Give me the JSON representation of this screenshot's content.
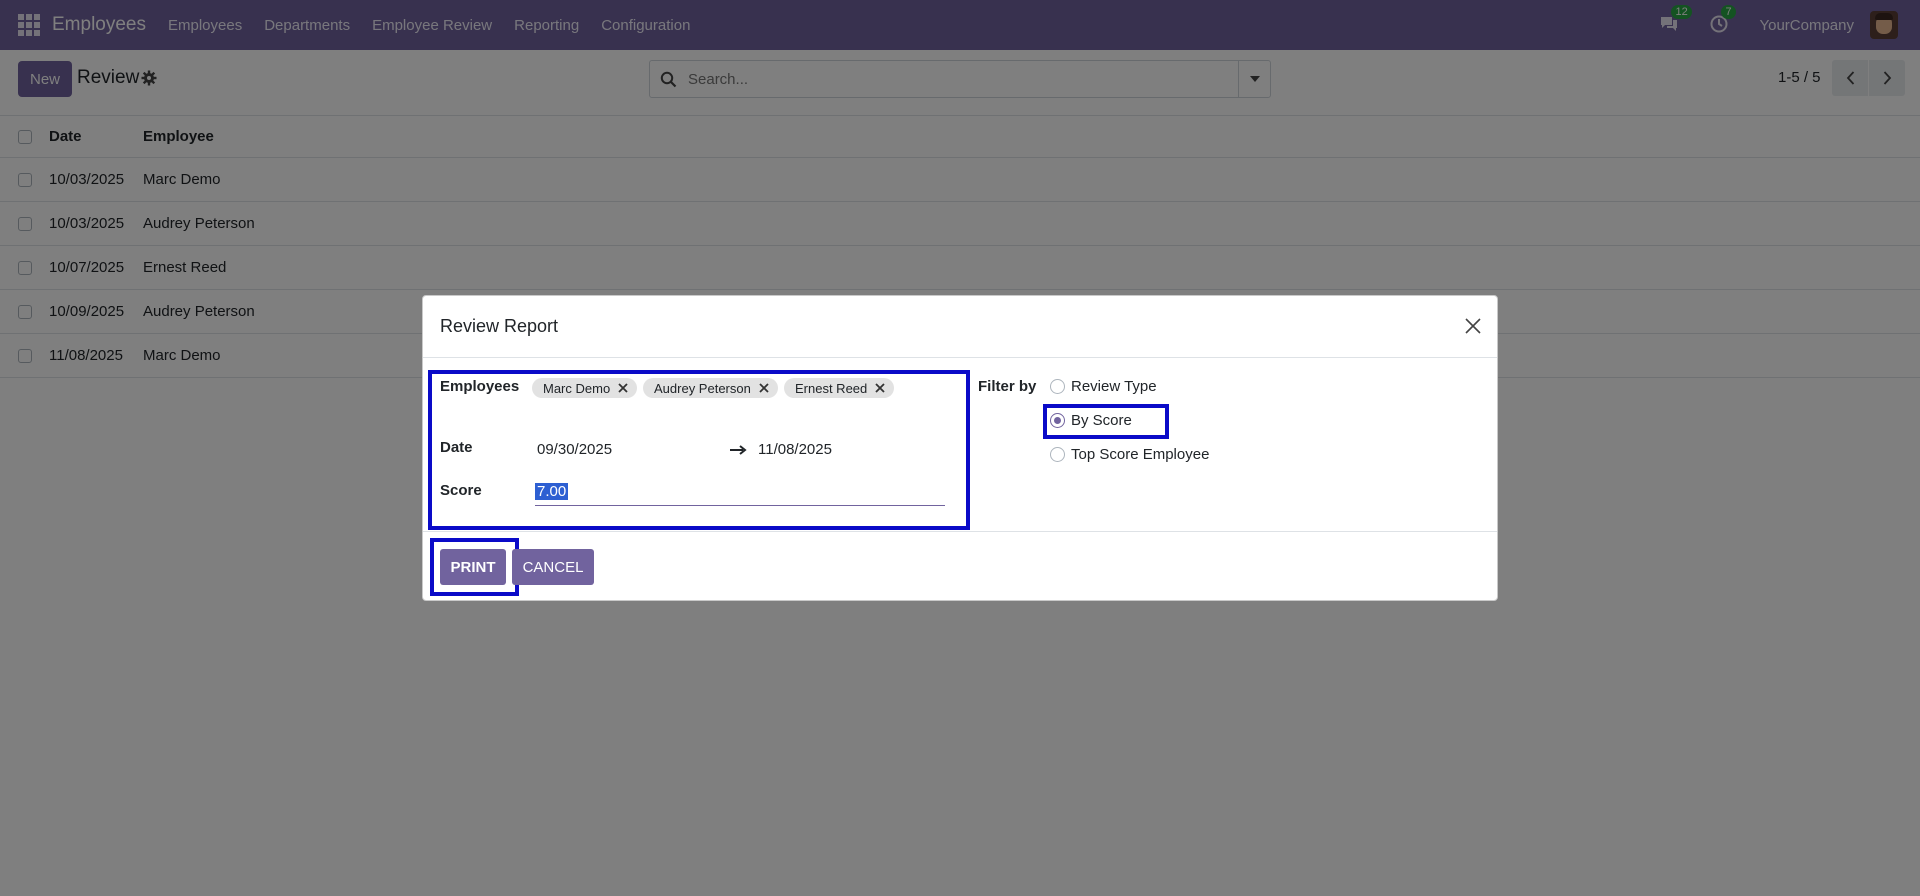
{
  "navbar": {
    "app_title": "Employees",
    "menu": [
      "Employees",
      "Departments",
      "Employee Review",
      "Reporting",
      "Configuration"
    ],
    "messages_count": "12",
    "activities_count": "7",
    "company": "YourCompany"
  },
  "control": {
    "new_label": "New",
    "breadcrumb": "Review",
    "search_placeholder": "Search...",
    "pager": "1-5 / 5"
  },
  "list": {
    "columns": [
      "Date",
      "Employee"
    ],
    "rows": [
      {
        "date": "10/03/2025",
        "employee": "Marc Demo"
      },
      {
        "date": "10/03/2025",
        "employee": "Audrey Peterson"
      },
      {
        "date": "10/07/2025",
        "employee": "Ernest Reed"
      },
      {
        "date": "10/09/2025",
        "employee": "Audrey Peterson"
      },
      {
        "date": "11/08/2025",
        "employee": "Marc Demo"
      }
    ]
  },
  "dialog": {
    "title": "Review Report",
    "employees_label": "Employees",
    "employee_tags": [
      "Marc Demo",
      "Audrey Peterson",
      "Ernest Reed"
    ],
    "date_label": "Date",
    "date_from": "09/30/2025",
    "date_to": "11/08/2025",
    "score_label": "Score",
    "score_value": "7.00",
    "filter_label": "Filter by",
    "filter_options": [
      "Review Type",
      "By Score",
      "Top Score Employee"
    ],
    "filter_selected": "By Score",
    "print_label": "PRINT",
    "cancel_label": "CANCEL"
  },
  "colors": {
    "brand": "#71639e",
    "highlight": "#0a0ac8",
    "badge": "#28a745"
  }
}
